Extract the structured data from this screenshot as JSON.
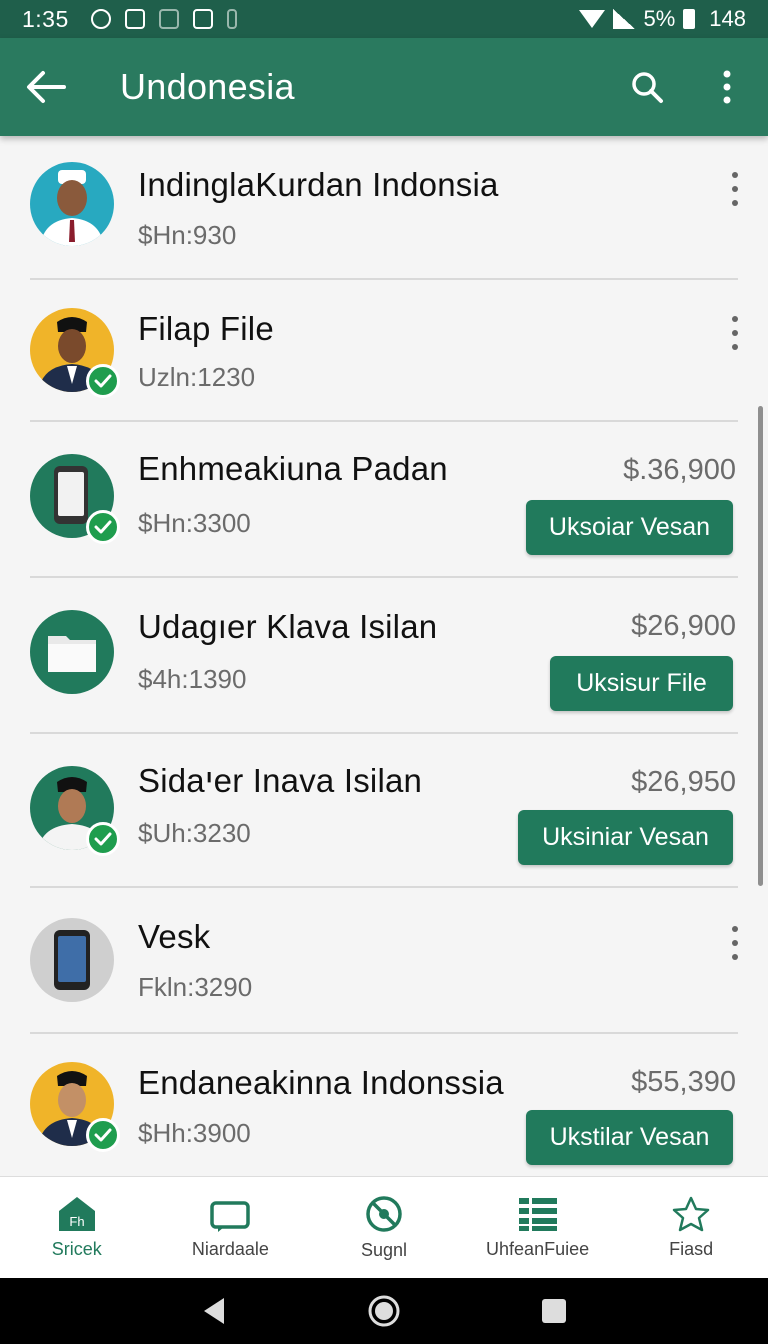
{
  "status_bar": {
    "time": "1:35",
    "battery_percent": "5%",
    "extra": "148"
  },
  "app_bar": {
    "title": "Undonesia"
  },
  "items": [
    {
      "title": "IndinglaKurdan Indonsia",
      "subtitle": "$Hn:930",
      "avatar_bg": "#28a9c0",
      "verified": false,
      "has_menu": true
    },
    {
      "title": "Filap File",
      "subtitle": "Uzln:1230",
      "avatar_bg": "#f0b429",
      "verified": true,
      "has_menu": true
    },
    {
      "title": "Enhmeakiuna Padan",
      "subtitle": "$Hn:3300",
      "price": "$.36,900",
      "button": "Uksoiar Vesan",
      "avatar_bg": "#217a5c",
      "verified": true
    },
    {
      "title": "Udagıer Klava Isilan",
      "subtitle": "$4h:1390",
      "price": "$26,900",
      "button": "Uksisur File",
      "avatar_bg": "#217a5c",
      "verified": false
    },
    {
      "title": "Sidaיer Inava Isilan",
      "subtitle": "$Uh:3230",
      "price": "$26,950",
      "button": "Uksiniar Vesan",
      "avatar_bg": "#217a5c",
      "verified": true
    },
    {
      "title": "Vesk",
      "subtitle": "Fkln:3290",
      "avatar_bg": "#cfcfcf",
      "verified": false,
      "has_menu": true
    },
    {
      "title": "Endaneakinna Indonssia",
      "subtitle": "$Hh:3900",
      "price": "$55,390",
      "button": "Ukstilar Vesan",
      "avatar_bg": "#f0b429",
      "verified": true
    }
  ],
  "bottom_nav": [
    {
      "label": "Sricek",
      "icon": "home-icon",
      "active": true
    },
    {
      "label": "Niardaale",
      "icon": "briefcase-icon",
      "active": false
    },
    {
      "label": "Sugnl",
      "icon": "blocked-icon",
      "active": false
    },
    {
      "label": "UhfeanFuiee",
      "icon": "list-icon",
      "active": false
    },
    {
      "label": "Fiasd",
      "icon": "star-icon",
      "active": false
    }
  ],
  "colors": {
    "primary": "#2a7a5f",
    "status_bar": "#1f5f4b",
    "button": "#217a5c",
    "check": "#1f9d4e"
  }
}
